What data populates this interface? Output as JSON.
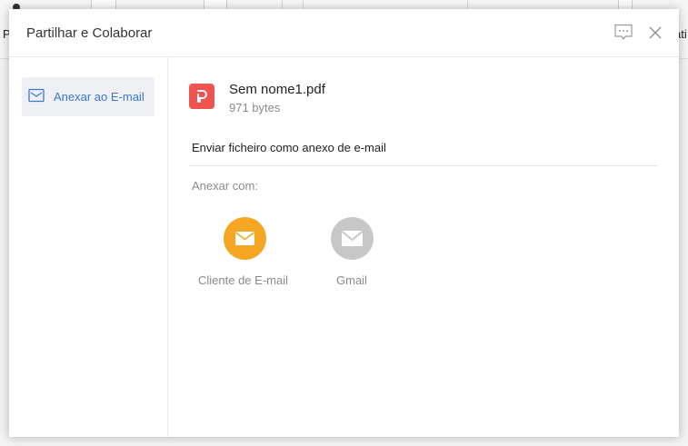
{
  "background": {
    "left_char": "P",
    "right_char": "ati"
  },
  "dialog": {
    "title": "Partilhar e Colaborar",
    "feedback_icon": "chat-bubble-icon",
    "close_icon": "close-icon"
  },
  "sidebar": {
    "items": [
      {
        "label": "Anexar ao E-mail",
        "icon": "mail-icon",
        "selected": true
      }
    ]
  },
  "file": {
    "name": "Sem nome1.pdf",
    "size": "971 bytes",
    "icon": "pdf-file-icon",
    "icon_color": "#ef5350"
  },
  "main": {
    "heading": "Enviar ficheiro como anexo de e-mail",
    "attach_label": "Anexar com:",
    "options": [
      {
        "label": "Cliente de E-mail",
        "icon": "mail-client-icon",
        "color": "#f5a623"
      },
      {
        "label": "Gmail",
        "icon": "gmail-icon",
        "color": "#c7c7c7"
      }
    ]
  },
  "colors": {
    "accent": "#3a78d4",
    "selected_bg": "#eef0f4"
  }
}
